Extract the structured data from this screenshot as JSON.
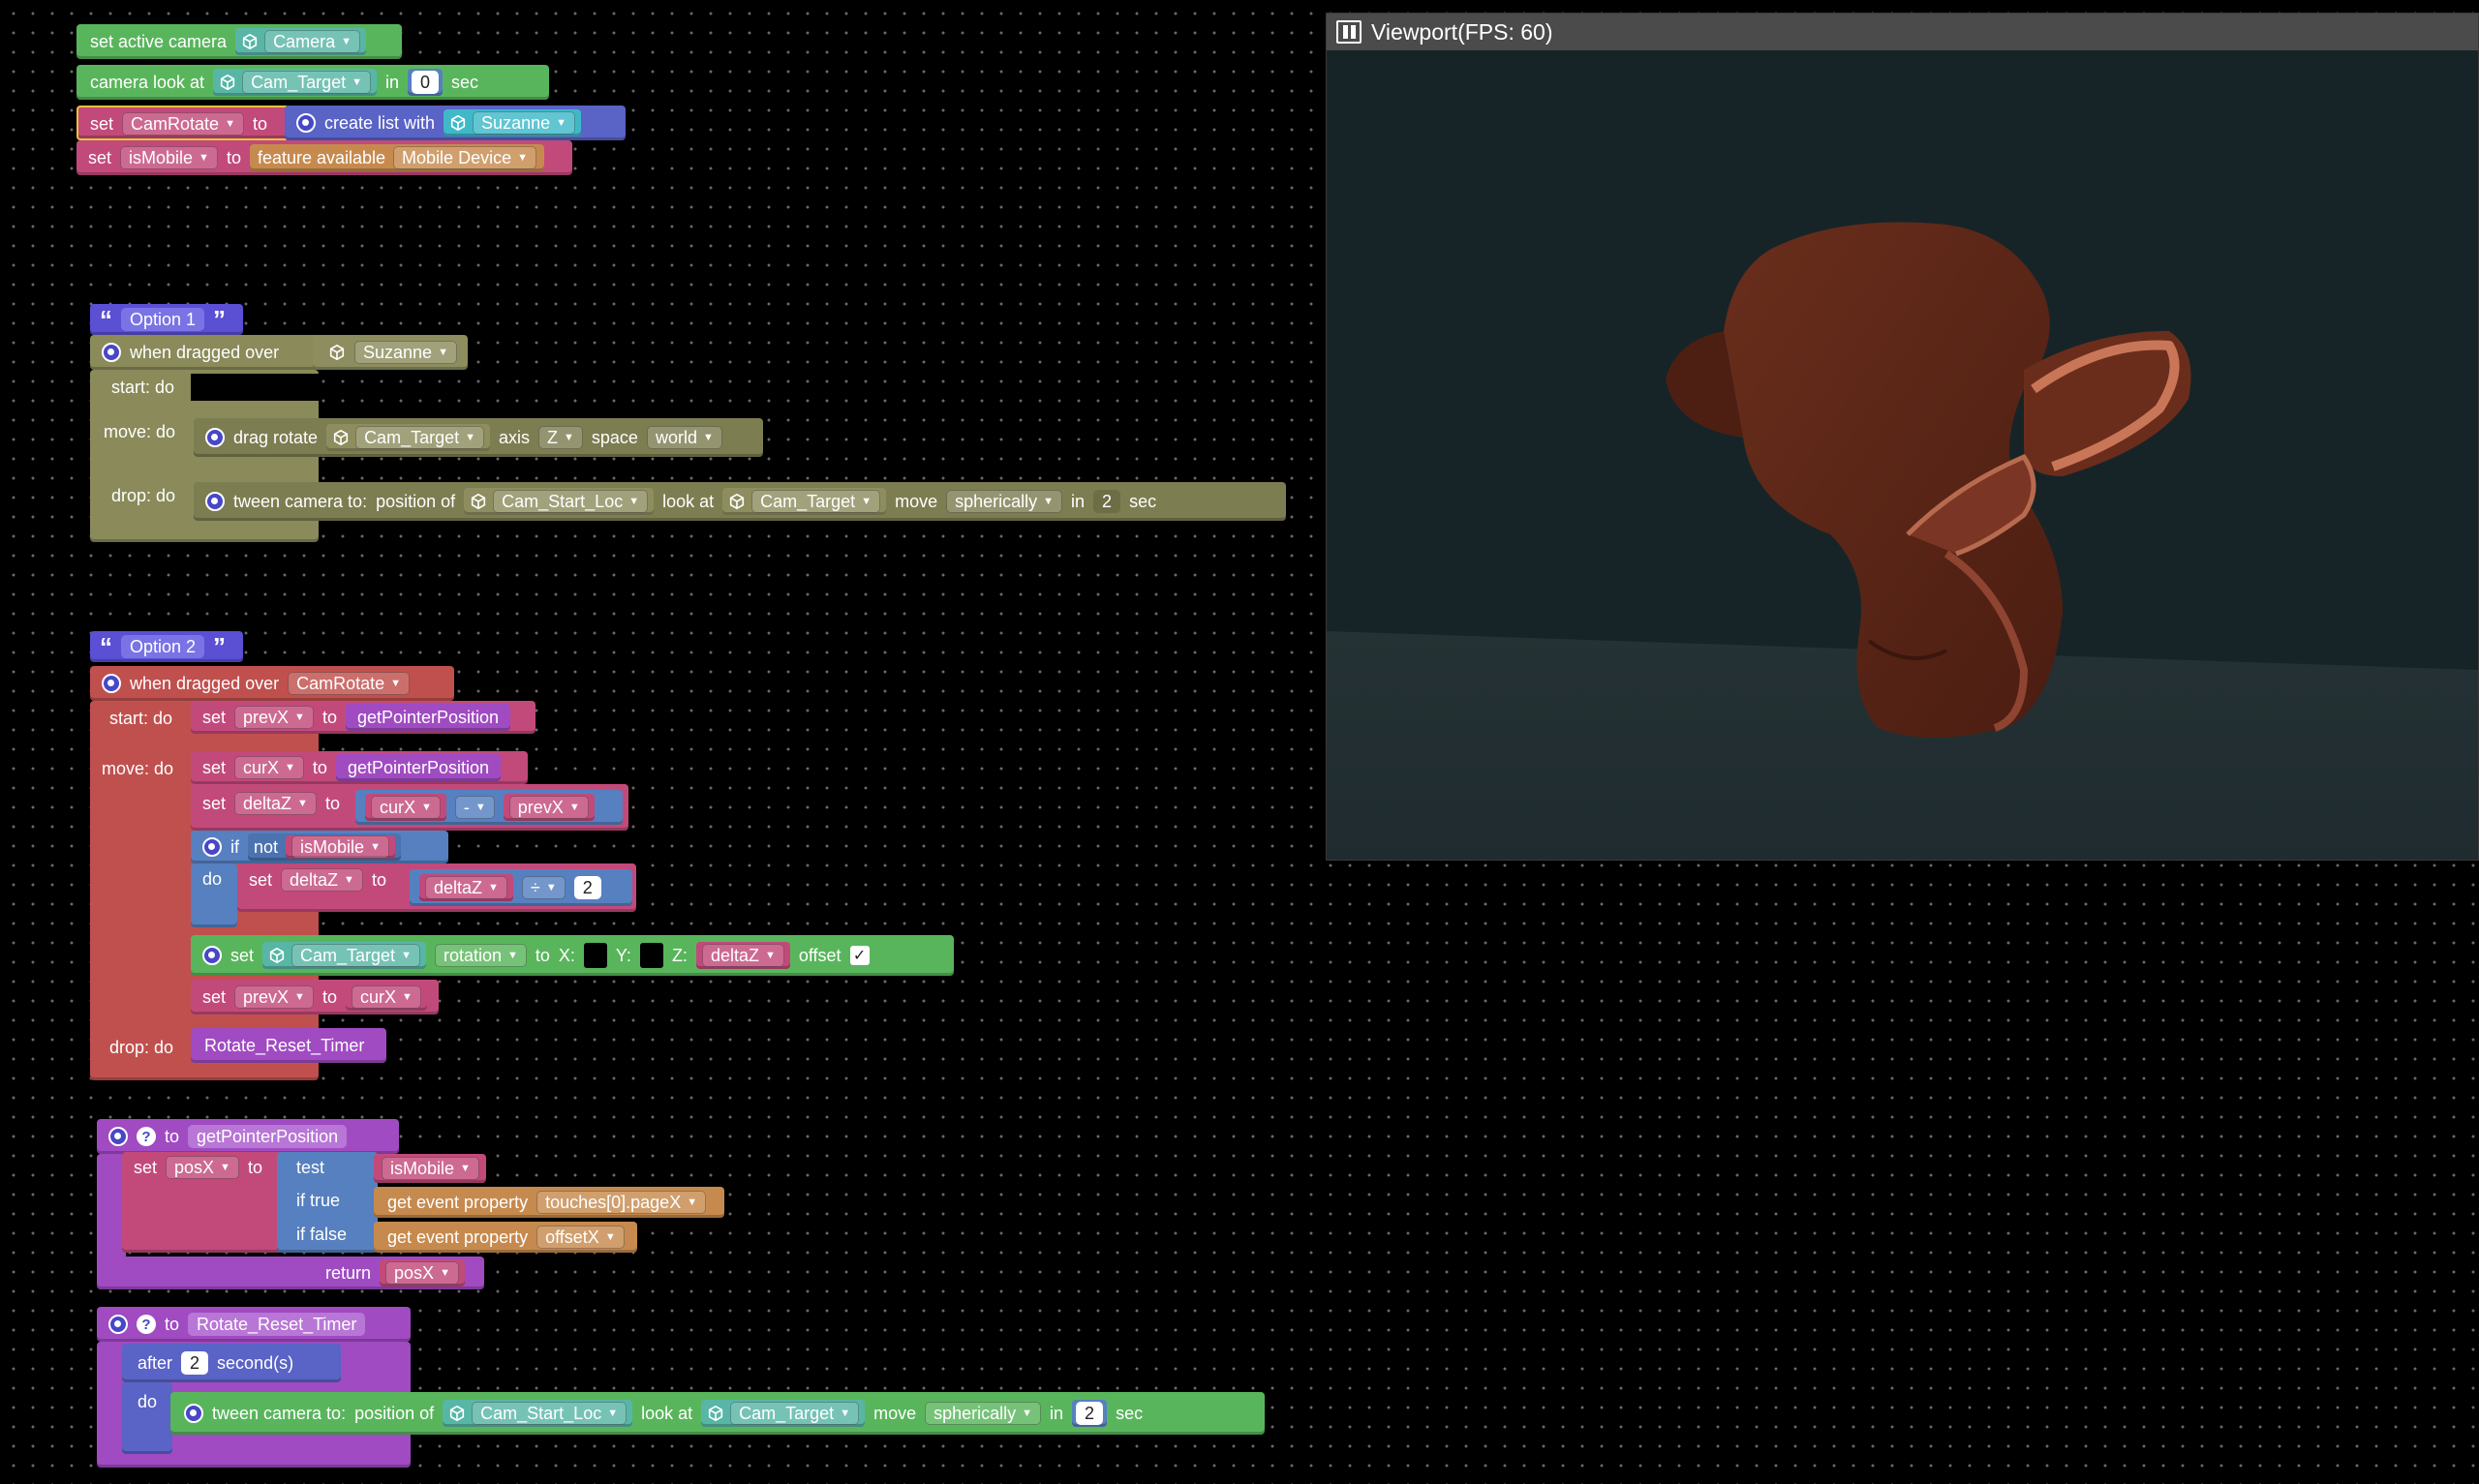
{
  "init": {
    "set_active_camera": "set active camera",
    "camera": "Camera",
    "camera_look_at": "camera look at",
    "cam_target": "Cam_Target",
    "in": "in",
    "zero": "0",
    "sec": "sec",
    "set": "set",
    "camrotate": "CamRotate",
    "to": "to",
    "create_list_with": "create list with",
    "suzanne": "Suzanne",
    "ismobile": "isMobile",
    "feature_available": "feature available",
    "mobile_device": "Mobile Device"
  },
  "option1": {
    "comment": "Option 1",
    "when_dragged_over": "when dragged over",
    "suzanne": "Suzanne",
    "start_do": "start: do",
    "move_do": "move: do",
    "drop_do": "drop: do",
    "drag_rotate": "drag rotate",
    "cam_target": "Cam_Target",
    "axis": "axis",
    "z": "Z",
    "space": "space",
    "world": "world",
    "tween_camera_to": "tween camera to:",
    "position_of": "position of",
    "cam_start_loc": "Cam_Start_Loc",
    "look_at": "look at",
    "move": "move",
    "spherically": "spherically",
    "in": "in",
    "two": "2",
    "sec": "sec"
  },
  "option2": {
    "comment": "Option 2",
    "when_dragged_over": "when dragged over",
    "camrotate": "CamRotate",
    "start_do": "start: do",
    "move_do": "move: do",
    "drop_do": "drop: do",
    "set": "set",
    "to": "to",
    "prevx": "prevX",
    "curx": "curX",
    "deltaz": "deltaZ",
    "get_pointer_position": "getPointerPosition",
    "minus": "-",
    "if": "if",
    "not": "not",
    "ismobile": "isMobile",
    "do": "do",
    "divide": "÷",
    "two": "2",
    "cam_target": "Cam_Target",
    "rotation": "rotation",
    "x_label": "X:",
    "y_label": "Y:",
    "z_label": "Z:",
    "offset": "offset",
    "rotate_reset_timer": "Rotate_Reset_Timer"
  },
  "func_pointer": {
    "to": "to",
    "name": "getPointerPosition",
    "set": "set",
    "posx": "posX",
    "to2": "to",
    "test": "test",
    "ismobile": "isMobile",
    "if_true": "if true",
    "if_false": "if false",
    "get_event_property": "get event property",
    "touches_pagex": "touches[0].pageX",
    "offsetx": "offsetX",
    "return": "return",
    "posx_ret": "posX"
  },
  "func_timer": {
    "to": "to",
    "name": "Rotate_Reset_Timer",
    "after": "after",
    "two": "2",
    "seconds": "second(s)",
    "do": "do",
    "tween_camera_to": "tween camera to:",
    "position_of": "position of",
    "cam_start_loc": "Cam_Start_Loc",
    "look_at": "look at",
    "cam_target": "Cam_Target",
    "move": "move",
    "spherically": "spherically",
    "in": "in",
    "two_b": "2",
    "sec": "sec"
  },
  "viewport": {
    "title": "Viewport(FPS: 60)"
  },
  "colors": {
    "event": "#59b55c",
    "variable": "#c24a7b",
    "procedure": "#a04bc2",
    "logic": "#5680c0",
    "comment": "#5b4fd4",
    "model": "#3d1a10"
  }
}
